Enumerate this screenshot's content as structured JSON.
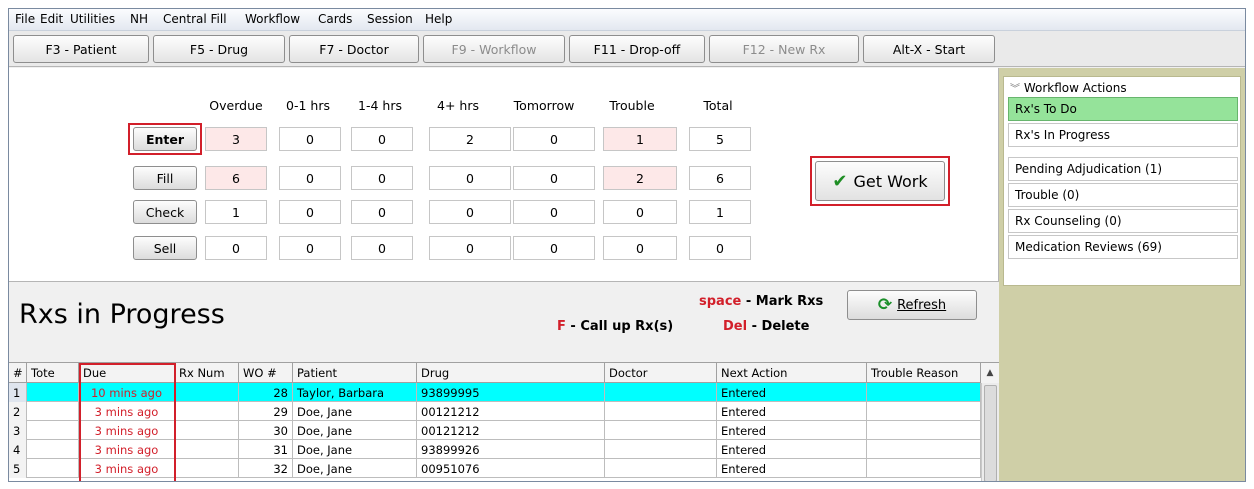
{
  "menu": [
    "File",
    "Edit",
    "Utilities",
    "NH",
    "Central Fill",
    "Workflow",
    "Cards",
    "Session",
    "Help"
  ],
  "fkeys": [
    {
      "label": "F3 - Patient",
      "disabled": false
    },
    {
      "label": "F5 - Drug",
      "disabled": false
    },
    {
      "label": "F7 - Doctor",
      "disabled": false
    },
    {
      "label": "F9 - Workflow",
      "disabled": true
    },
    {
      "label": "F11 - Drop-off",
      "disabled": false
    },
    {
      "label": "F12 - New Rx",
      "disabled": true
    },
    {
      "label": "Alt-X - Start",
      "disabled": false
    }
  ],
  "counts": {
    "columns": [
      "Overdue",
      "0-1 hrs",
      "1-4 hrs",
      "4+ hrs",
      "Tomorrow",
      "Trouble",
      "Total"
    ],
    "rows": [
      {
        "label": "Enter",
        "values": [
          "3",
          "0",
          "0",
          "2",
          "0",
          "1",
          "5"
        ]
      },
      {
        "label": "Fill",
        "values": [
          "6",
          "0",
          "0",
          "0",
          "0",
          "2",
          "6"
        ]
      },
      {
        "label": "Check",
        "values": [
          "1",
          "0",
          "0",
          "0",
          "0",
          "0",
          "1"
        ]
      },
      {
        "label": "Sell",
        "values": [
          "0",
          "0",
          "0",
          "0",
          "0",
          "0",
          "0"
        ]
      }
    ],
    "get_work_label": "Get Work"
  },
  "workflow_actions": {
    "title": "Workflow Actions",
    "top_items": [
      "Rx's To Do",
      "Rx's In Progress"
    ],
    "items": [
      "Pending Adjudication (1)",
      "Trouble (0)",
      "Rx Counseling (0)",
      "Medication Reviews (69)"
    ]
  },
  "rx_progress": {
    "title": "Rxs in Progress",
    "hint_space_key": "space",
    "hint_space_text": " - Mark Rxs",
    "hint_f_key": "F",
    "hint_f_text": " - Call up Rx(s)",
    "hint_del_key": "Del",
    "hint_del_text": " - Delete",
    "refresh_label": "Refresh",
    "columns": [
      "#",
      "Tote",
      "Due",
      "Rx Num",
      "WO #",
      "Patient",
      "Drug",
      "Doctor",
      "Next Action",
      "Trouble Reason"
    ],
    "rows": [
      {
        "num": "1",
        "tote": "",
        "due": "10 mins ago",
        "rxnum": "",
        "wo": "28",
        "patient": "Taylor, Barbara",
        "drug": "93899995",
        "doctor": "",
        "next": "Entered",
        "trouble": ""
      },
      {
        "num": "2",
        "tote": "",
        "due": "3 mins ago",
        "rxnum": "",
        "wo": "29",
        "patient": "Doe, Jane",
        "drug": "00121212",
        "doctor": "",
        "next": "Entered",
        "trouble": ""
      },
      {
        "num": "3",
        "tote": "",
        "due": "3 mins ago",
        "rxnum": "",
        "wo": "30",
        "patient": "Doe, Jane",
        "drug": "00121212",
        "doctor": "",
        "next": "Entered",
        "trouble": ""
      },
      {
        "num": "4",
        "tote": "",
        "due": "3 mins ago",
        "rxnum": "",
        "wo": "31",
        "patient": "Doe, Jane",
        "drug": "93899926",
        "doctor": "",
        "next": "Entered",
        "trouble": ""
      },
      {
        "num": "5",
        "tote": "",
        "due": "3 mins ago",
        "rxnum": "",
        "wo": "32",
        "patient": "Doe, Jane",
        "drug": "00951076",
        "doctor": "",
        "next": "Entered",
        "trouble": ""
      }
    ]
  },
  "colors": {
    "highlight_red": "#d21f2a",
    "selected_row": "#00ffff",
    "active_action": "#95e39a",
    "panel_bg": "#cfcfa7"
  }
}
